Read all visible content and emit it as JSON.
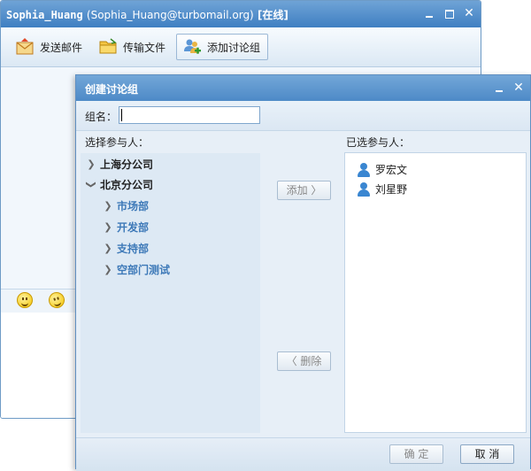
{
  "chat_window": {
    "title_account": "Sophia_Huang",
    "title_email": "(Sophia_Huang@turbomail.org)",
    "title_status": "[在线]",
    "toolbar": {
      "send_mail": "发送邮件",
      "transfer_file": "传输文件",
      "add_group": "添加讨论组"
    },
    "icons": [
      "mail-icon",
      "folder-icon",
      "group-add-icon",
      "smiley-icon",
      "wave-smiley-icon",
      "minimize-icon",
      "maximize-icon",
      "close-icon"
    ]
  },
  "dialog": {
    "title": "创建讨论组",
    "group_name_label": "组名：",
    "group_name_value": "",
    "select_label": "选择参与人：",
    "selected_label": "已选参与人：",
    "tree": [
      {
        "label": "上海分公司",
        "level": 0,
        "expanded": false
      },
      {
        "label": "北京分公司",
        "level": 0,
        "expanded": true
      },
      {
        "label": "市场部",
        "level": 1,
        "expanded": false
      },
      {
        "label": "开发部",
        "level": 1,
        "expanded": false
      },
      {
        "label": "支持部",
        "level": 1,
        "expanded": false
      },
      {
        "label": "空部门测试",
        "level": 1,
        "expanded": false
      }
    ],
    "add_button": "添加 〉",
    "remove_button": "〈 删除",
    "selected": [
      "罗宏文",
      "刘星野"
    ],
    "ok_button": "确 定",
    "cancel_button": "取 消"
  }
}
